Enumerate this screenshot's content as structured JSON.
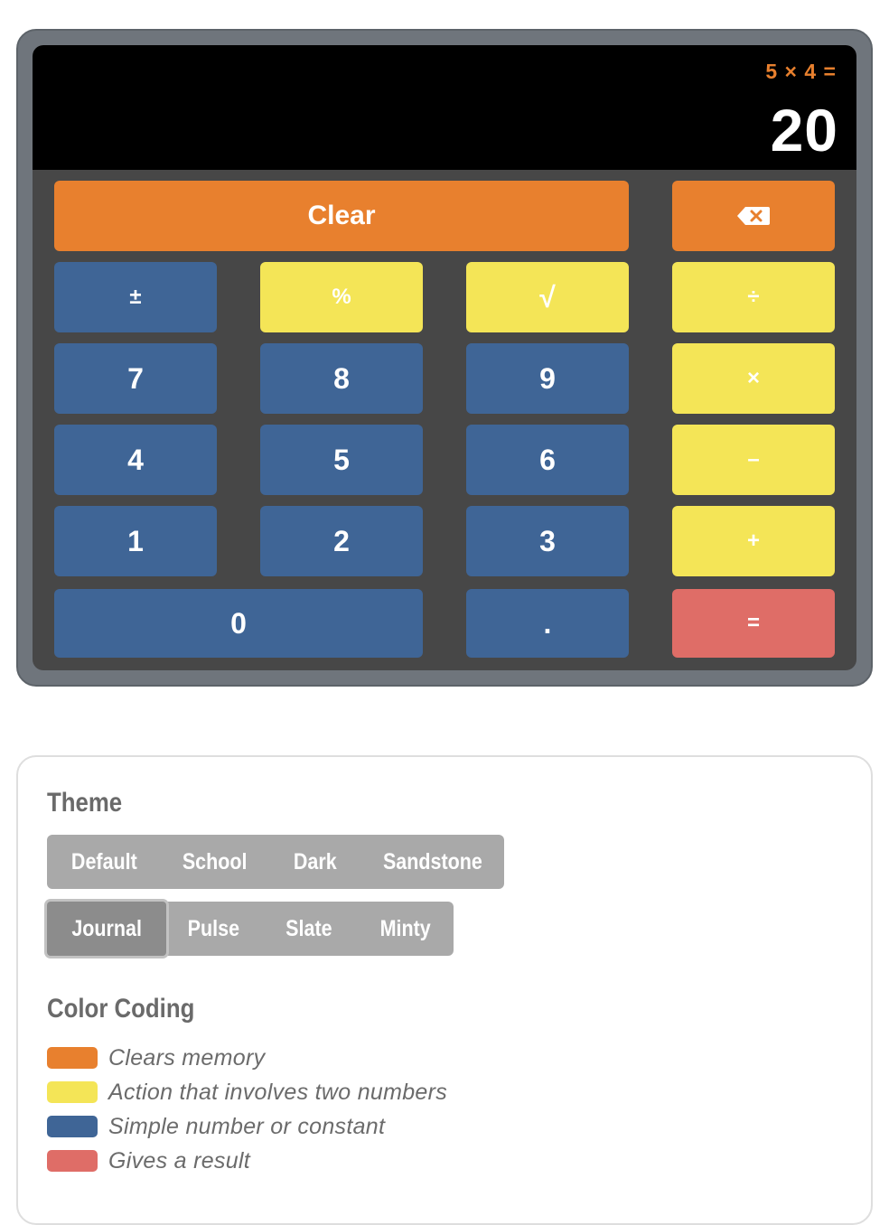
{
  "display": {
    "expression": "5 × 4 =",
    "result": "20"
  },
  "keys": {
    "clear": "Clear",
    "backspace_icon": "backspace-icon",
    "plus_minus": "±",
    "percent": "%",
    "sqrt": "√",
    "divide": "÷",
    "seven": "7",
    "eight": "8",
    "nine": "9",
    "multiply": "×",
    "four": "4",
    "five": "5",
    "six": "6",
    "minus": "–",
    "one": "1",
    "two": "2",
    "three": "3",
    "plus": "+",
    "zero": "0",
    "decimal": ".",
    "equals": "="
  },
  "theme": {
    "title": "Theme",
    "row1": [
      "Default",
      "School",
      "Dark",
      "Sandstone"
    ],
    "row2": [
      "Journal",
      "Pulse",
      "Slate",
      "Minty"
    ],
    "active": "Journal"
  },
  "color_coding": {
    "title": "Color Coding",
    "items": [
      {
        "label": "Clears memory",
        "color": "#e8802e"
      },
      {
        "label": "Action that involves two numbers",
        "color": "#f4e557"
      },
      {
        "label": "Simple number or constant",
        "color": "#3f6596"
      },
      {
        "label": "Gives a result",
        "color": "#df6d67"
      }
    ]
  }
}
